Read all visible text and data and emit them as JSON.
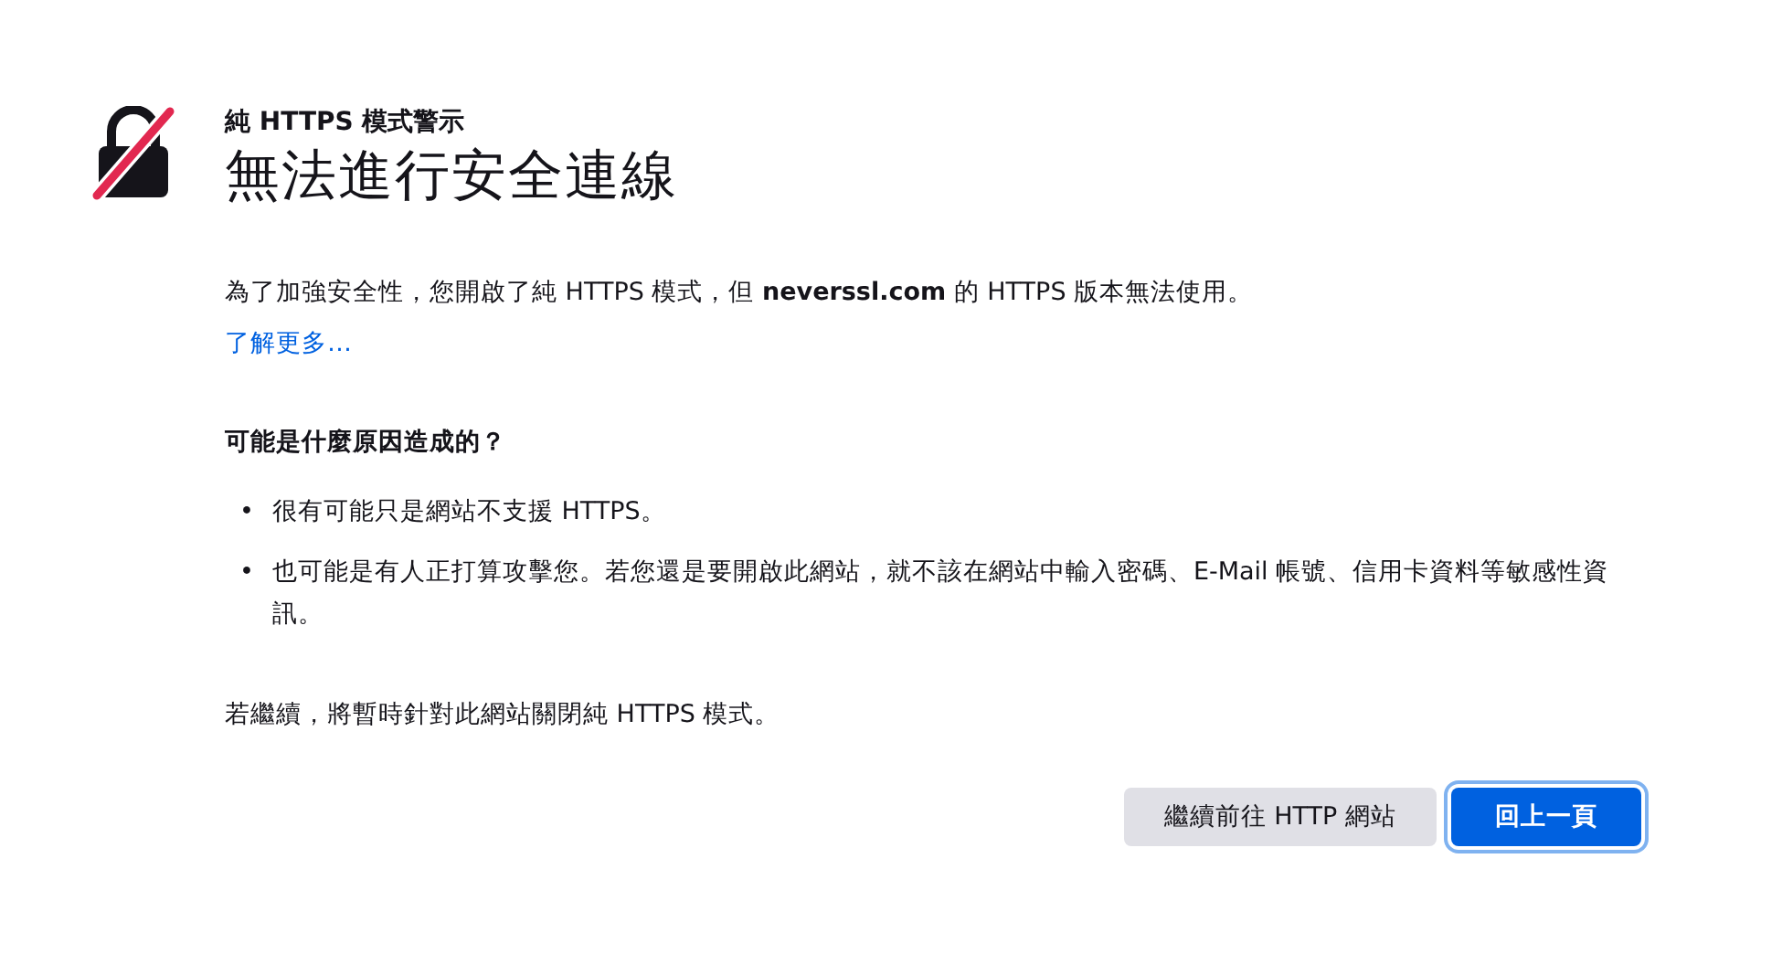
{
  "header": {
    "subtitle": "純 HTTPS 模式警示",
    "title": "無法進行安全連線"
  },
  "intro": "為了加強安全性，您開啟了純 HTTPS 模式，但 **neverssl.com** 的 HTTPS 版本無法使用。",
  "learn_more": "了解更多…",
  "reasons_heading": "可能是什麼原因造成的？",
  "reasons": [
    {
      "bullet": "•",
      "text": "很有可能只是網站不支援 HTTPS。"
    },
    {
      "bullet": "•",
      "text": "也可能是有人正打算攻擊您。若您還是要開啟此網站，就不該在網站中輸入密碼、E-Mail 帳號、信用卡資料等敏感性資訊。"
    }
  ],
  "note": "若繼續，將暫時針對此網站關閉純 HTTPS 模式。",
  "buttons": [
    {
      "label": "繼續前往 HTTP 網站",
      "kind": "secondary"
    },
    {
      "label": "回上一頁",
      "kind": "primary"
    }
  ]
}
